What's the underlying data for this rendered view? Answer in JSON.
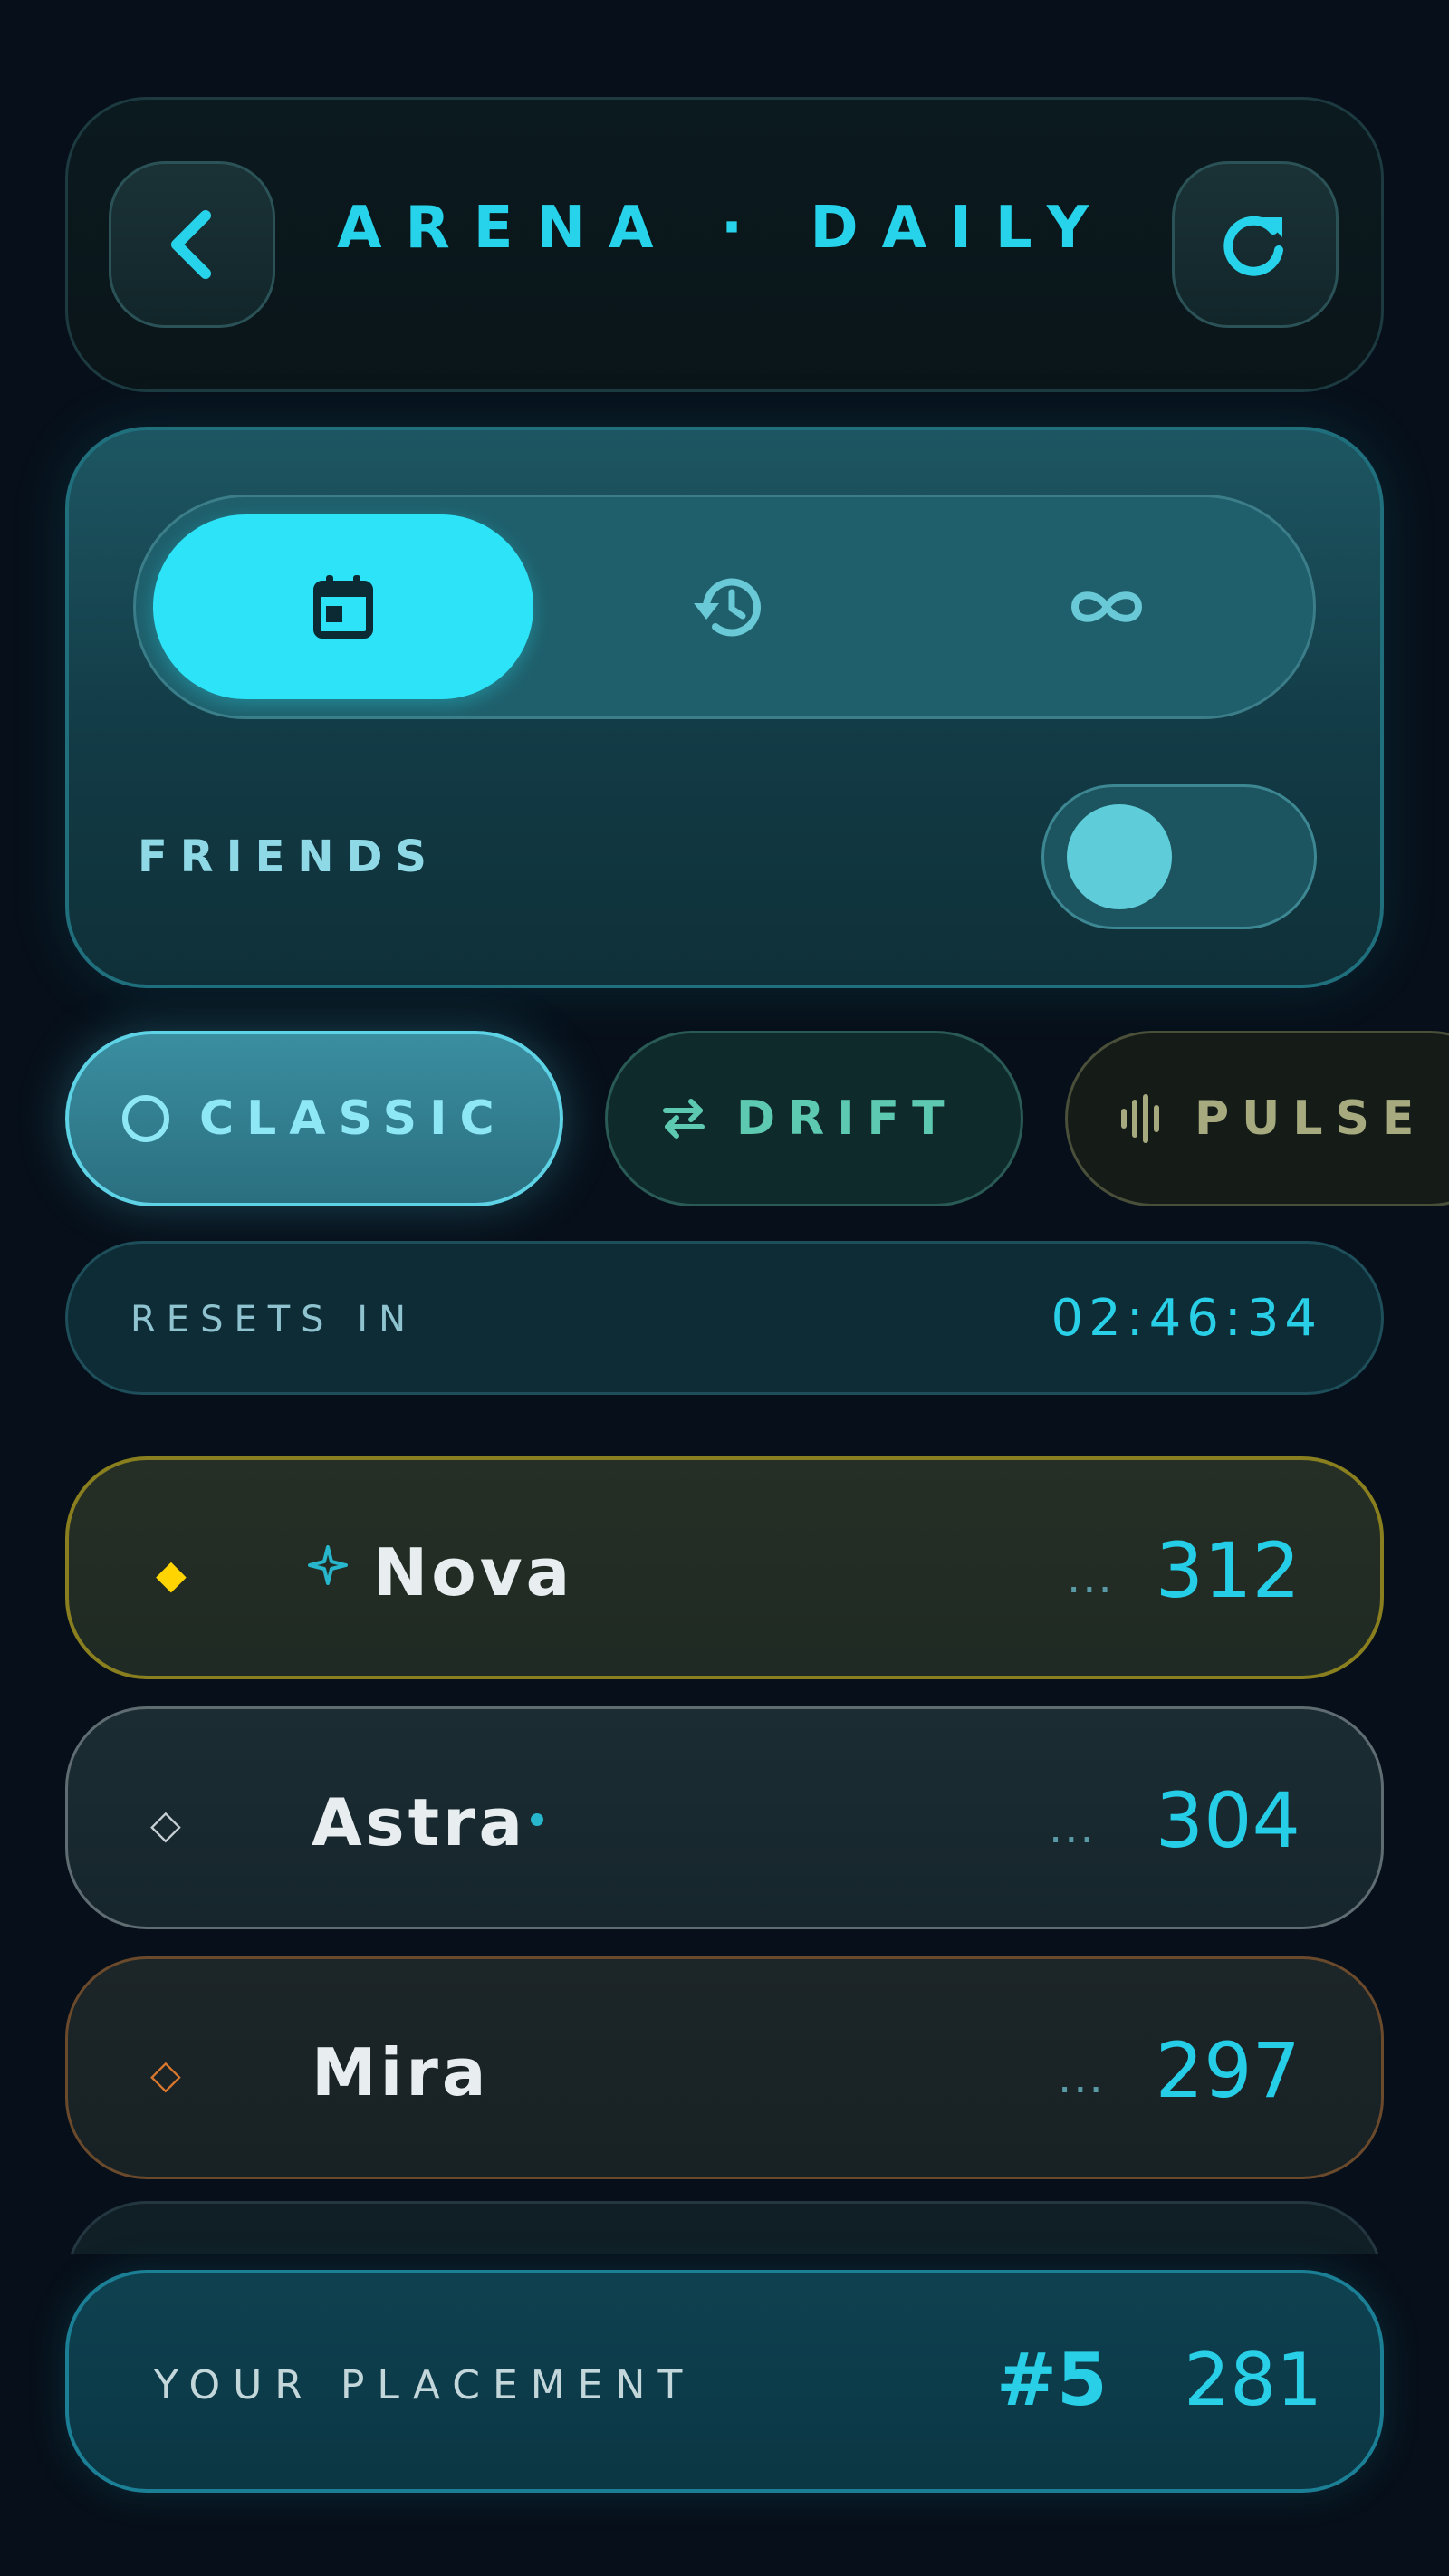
{
  "header": {
    "title": "ARENA · DAILY",
    "back_icon": "chevron-left-icon",
    "refresh_icon": "refresh-icon"
  },
  "period_tabs": [
    {
      "icon": "calendar-icon",
      "active": true
    },
    {
      "icon": "history-icon",
      "active": false
    },
    {
      "icon": "infinity-icon",
      "active": false
    }
  ],
  "friends": {
    "label": "FRIENDS",
    "enabled": false
  },
  "modes": [
    {
      "label": "CLASSIC",
      "icon": "circle-icon",
      "active": true
    },
    {
      "label": "DRIFT",
      "icon": "swap-arrows-icon",
      "active": false
    },
    {
      "label": "PULSE",
      "icon": "waveform-icon",
      "active": false
    }
  ],
  "resets": {
    "label": "RESETS IN",
    "time": "02:46:34"
  },
  "leaderboard": [
    {
      "name": "Nova",
      "score": "312",
      "badge": "sparkle-icon",
      "rank_color": "#ffd400"
    },
    {
      "name": "Astra",
      "score": "304",
      "badge": "dot",
      "rank_color": "#c7d0d4"
    },
    {
      "name": "Mira",
      "score": "297",
      "badge": "",
      "rank_color": "#d9782e"
    }
  ],
  "more_indicator": "...",
  "placement": {
    "label": "YOUR PLACEMENT",
    "rank": "#5",
    "score": "281"
  },
  "colors": {
    "accent": "#2ce3f7",
    "background": "#07101a",
    "gold": "#ffd400",
    "silver": "#c7d0d4",
    "bronze": "#d9782e"
  }
}
